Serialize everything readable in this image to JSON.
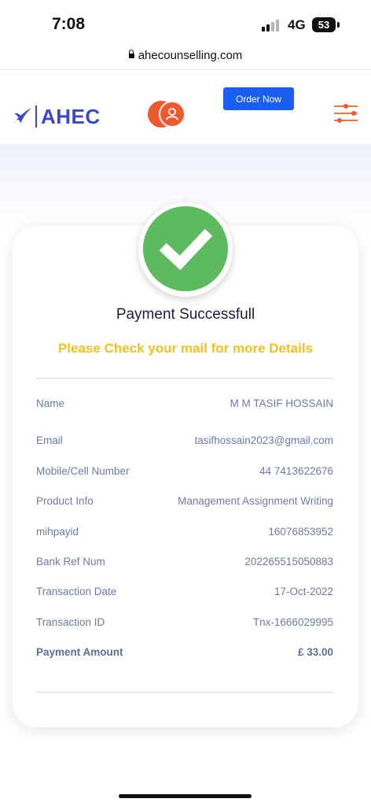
{
  "status_bar": {
    "time": "7:08",
    "network": "4G",
    "battery": "53"
  },
  "browser": {
    "url": "ahecounselling.com"
  },
  "header": {
    "logo_text": "AHEC",
    "order_button": "Order Now"
  },
  "colors": {
    "brand_blue": "#3b49c9",
    "order_button": "#1a5ef2",
    "success_green": "#5dba5f",
    "highlight_yellow": "#f5bf1c",
    "accent_orange": "#ee5a2f"
  },
  "payment": {
    "title": "Payment Successfull",
    "subtitle": "Please Check your mail for more Details",
    "details": [
      {
        "label": "Name",
        "value": "M M TASIF HOSSAIN"
      },
      {
        "label": "Email",
        "value": "tasifhossain2023@gmail.com"
      },
      {
        "label": "Mobile/Cell Number",
        "value": "44 7413622676"
      },
      {
        "label": "Product Info",
        "value": "Management Assignment Writing"
      },
      {
        "label": "mihpayid",
        "value": "16076853952"
      },
      {
        "label": "Bank Ref Num",
        "value": "202265515050883"
      },
      {
        "label": "Transaction Date",
        "value": "17-Oct-2022"
      },
      {
        "label": "Transaction ID",
        "value": "Tnx-1666029995"
      },
      {
        "label": "Payment Amount",
        "value": "£ 33.00"
      }
    ]
  }
}
